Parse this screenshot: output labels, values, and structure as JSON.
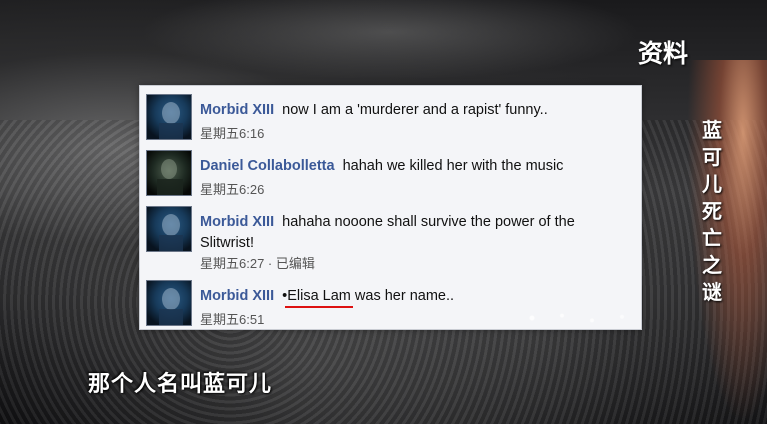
{
  "overlay": {
    "corner_label": "资料",
    "vertical_title": [
      "蓝",
      "可",
      "儿",
      "死",
      "亡",
      "之",
      "谜"
    ],
    "subtitle": "那个人名叫蓝可儿"
  },
  "chat": {
    "messages": [
      {
        "author": "Morbid XIII",
        "text": "now I am a 'murderer and a rapist' funny..",
        "time": "星期五6:16"
      },
      {
        "author": "Daniel Collabolletta",
        "text": "hahah we killed her with the music",
        "time": "星期五6:26"
      },
      {
        "author": "Morbid XIII",
        "text": "hahaha nooone shall survive the power of the Slitwrist!",
        "time": "星期五6:27",
        "edited": " · 已编辑"
      },
      {
        "author": "Morbid XIII",
        "text_prefix": "•",
        "text_highlight": "Elisa Lam",
        "text_suffix": " was her name..",
        "time": "星期五6:51"
      }
    ]
  },
  "colors": {
    "author": "#3b5998",
    "underline": "#dd1111",
    "panel_bg": "#f4f5f8"
  }
}
